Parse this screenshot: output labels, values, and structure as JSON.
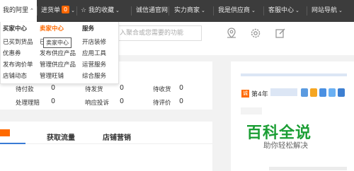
{
  "topnav": {
    "my_alibaba": "我的阿里",
    "purchase_list": "进货单",
    "purchase_count": "0",
    "favorites": "我的收藏",
    "chengxintong": "诚信通官网",
    "strong_merchant": "实力商家",
    "i_am_supplier": "我是供应商",
    "customer_service": "客服中心",
    "site_nav": "网站导航"
  },
  "search": {
    "placeholder": "入聚合或您需要的功能"
  },
  "dropdown": {
    "buyer_center": "买家中心",
    "seller_center": "卖家中心",
    "services": "服务",
    "buyer_links": [
      "已买到货品",
      "优惠券",
      "发布询价单",
      "店铺动态"
    ],
    "seller_links": [
      "已",
      "发布供应产品",
      "管理供应产品",
      "管理旺铺"
    ],
    "service_links": [
      "开店装修",
      "应用工具",
      "运营服务",
      "综合服务"
    ],
    "tooltip": "卖家中心"
  },
  "stats": {
    "row1": [
      {
        "label": "待付款",
        "value": "0"
      },
      {
        "label": "待发货",
        "value": "0"
      },
      {
        "label": "待收货",
        "value": "0"
      }
    ],
    "row2": [
      {
        "label": "处理理赔",
        "value": "0"
      },
      {
        "label": "响应投诉",
        "value": "0"
      },
      {
        "label": "待评价",
        "value": "0"
      }
    ]
  },
  "tabs": {
    "tab1": "获取流量",
    "tab2": "店铺营销"
  },
  "right_panel": {
    "year_badge": "诚",
    "year_text": "第4年"
  },
  "watermark": {
    "title": "百科全说",
    "subtitle": "助你轻松解决"
  },
  "colors": {
    "accent": "#ff6a00",
    "topbar": "#3c3c3c",
    "watermark": "#1b9e34"
  }
}
